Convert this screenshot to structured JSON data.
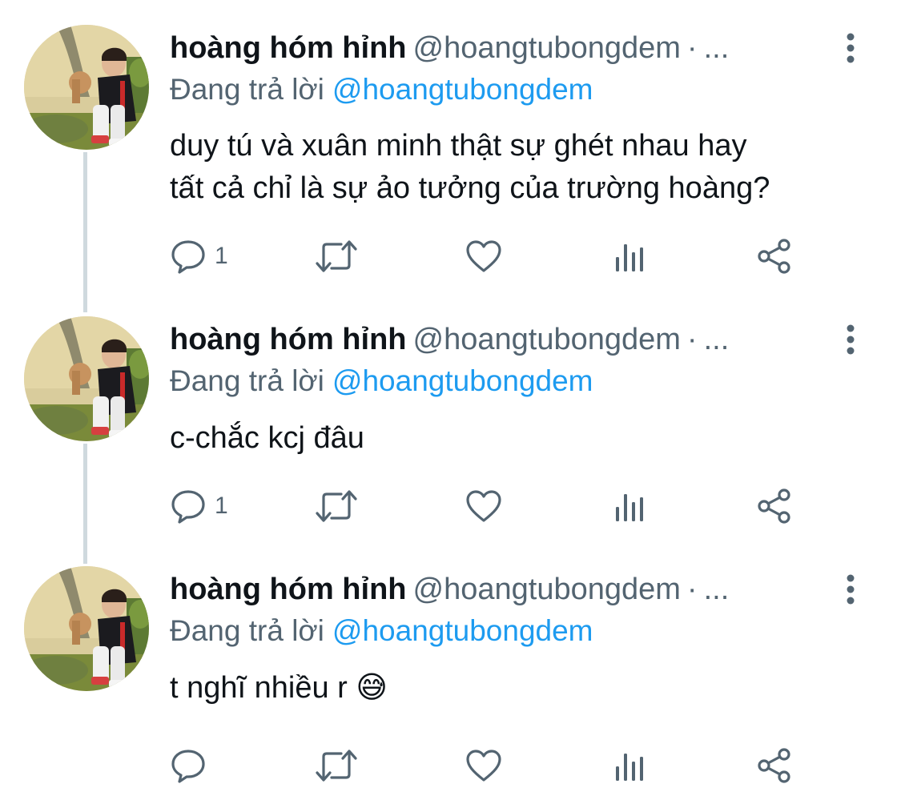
{
  "colors": {
    "text_primary": "#0f1419",
    "text_secondary": "#536471",
    "link": "#1d9bf0",
    "thread_line": "#cfd9de"
  },
  "tweets": [
    {
      "display_name": "hoàng hóm hỉnh",
      "handle": "@hoangtubongdem",
      "separator": "·",
      "truncation": "...",
      "reply_prefix": "Đang trả lời",
      "reply_to": "@hoangtubongdem",
      "text": "duy tú và xuân minh thật sự ghét nhau hay\ntất cả chỉ là sự ảo tưởng của trường hoàng?",
      "emoji": "",
      "reply_count": "1",
      "icons": [
        "reply-icon",
        "retweet-icon",
        "like-icon",
        "analytics-icon",
        "share-icon",
        "more-vertical-icon"
      ]
    },
    {
      "display_name": "hoàng hóm hỉnh",
      "handle": "@hoangtubongdem",
      "separator": "·",
      "truncation": "...",
      "reply_prefix": "Đang trả lời",
      "reply_to": "@hoangtubongdem",
      "text": "c-chắc kcj đâu",
      "emoji": "",
      "reply_count": "1",
      "icons": [
        "reply-icon",
        "retweet-icon",
        "like-icon",
        "analytics-icon",
        "share-icon",
        "more-vertical-icon"
      ]
    },
    {
      "display_name": "hoàng hóm hỉnh",
      "handle": "@hoangtubongdem",
      "separator": "·",
      "truncation": "...",
      "reply_prefix": "Đang trả lời",
      "reply_to": "@hoangtubongdem",
      "text": "t nghĩ nhiều r ",
      "emoji": "😅",
      "reply_count": "",
      "icons": [
        "reply-icon",
        "retweet-icon",
        "like-icon",
        "analytics-icon",
        "share-icon",
        "more-vertical-icon"
      ]
    }
  ]
}
